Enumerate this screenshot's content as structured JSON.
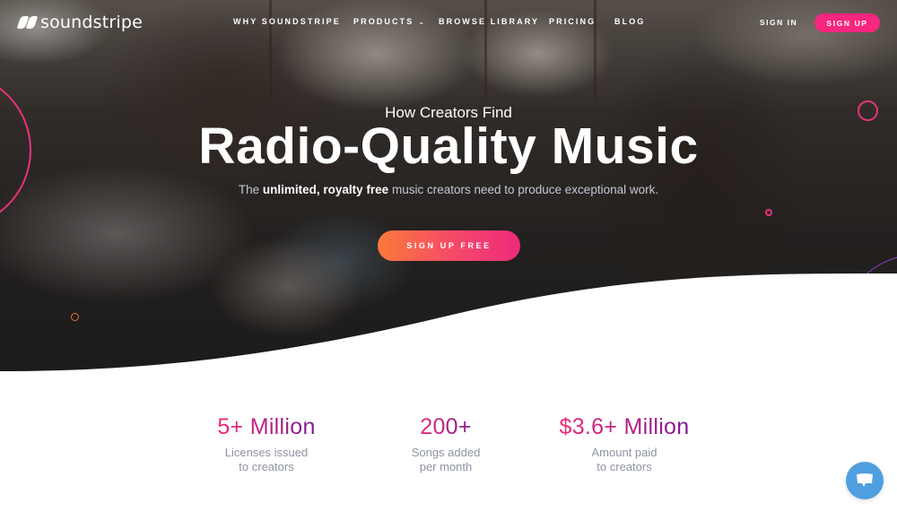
{
  "brand": {
    "name": "soundstripe",
    "accent": "#f7267e",
    "chat_color": "#4f9fe0"
  },
  "nav": {
    "links": [
      {
        "label": "WHY SOUNDSTRIPE",
        "has_dropdown": false
      },
      {
        "label": "PRODUCTS",
        "has_dropdown": true
      },
      {
        "label": "BROWSE LIBRARY",
        "has_dropdown": false
      },
      {
        "label": "PRICING",
        "has_dropdown": false
      },
      {
        "label": "BLOG",
        "has_dropdown": false
      }
    ],
    "sign_in": "SIGN IN",
    "sign_up": "SIGN UP"
  },
  "hero": {
    "kicker": "How Creators Find",
    "headline": "Radio-Quality Music",
    "subhead": {
      "pre": "The ",
      "bold": "unlimited, royalty free",
      "post": " music creators need to produce exceptional work."
    },
    "cta": "SIGN UP FREE"
  },
  "stats": [
    {
      "value": "5+ Million",
      "label_line1": "Licenses issued",
      "label_line2": "to creators"
    },
    {
      "value": "200+",
      "label_line1": "Songs added",
      "label_line2": "per month"
    },
    {
      "value": "$3.6+ Million",
      "label_line1": "Amount paid",
      "label_line2": "to creators"
    }
  ],
  "chat": {
    "icon": "chat-bubble-icon"
  }
}
